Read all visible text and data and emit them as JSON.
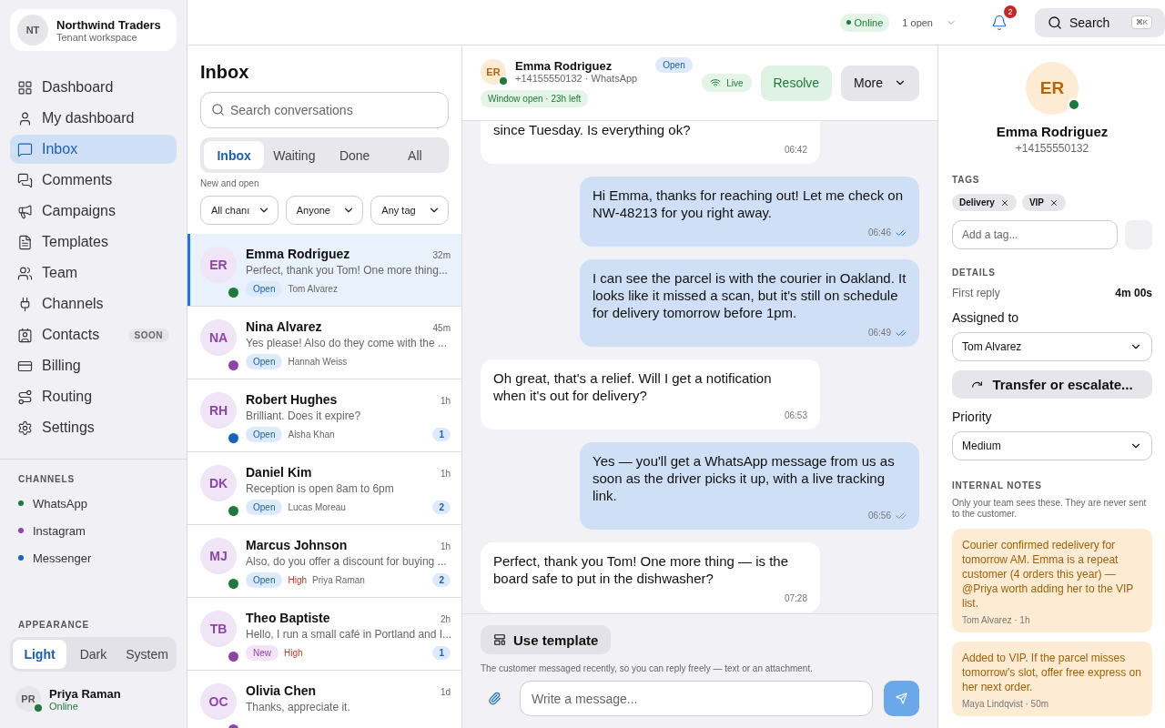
{
  "workspace": {
    "initials": "NT",
    "name": "Northwind Traders",
    "subtitle": "Tenant workspace"
  },
  "nav": [
    {
      "label": "Dashboard",
      "selected": false
    },
    {
      "label": "My dashboard",
      "selected": false
    },
    {
      "label": "Inbox",
      "selected": true
    },
    {
      "label": "Comments",
      "selected": false
    },
    {
      "label": "Campaigns",
      "selected": false
    },
    {
      "label": "Templates",
      "selected": false
    },
    {
      "label": "Team",
      "selected": false
    },
    {
      "label": "Channels",
      "selected": false
    },
    {
      "label": "Contacts",
      "selected": false,
      "badge": "SOON"
    },
    {
      "label": "Billing",
      "selected": false
    },
    {
      "label": "Routing",
      "selected": false
    },
    {
      "label": "Settings",
      "selected": false
    }
  ],
  "channels": {
    "title": "CHANNELS",
    "items": [
      {
        "label": "WhatsApp",
        "color": "#1e7a3a"
      },
      {
        "label": "Instagram",
        "color": "#8e44ad"
      },
      {
        "label": "Messenger",
        "color": "#1565c0"
      }
    ]
  },
  "appearance": {
    "title": "APPEARANCE",
    "options": [
      {
        "label": "Light",
        "selected": true
      },
      {
        "label": "Dark",
        "selected": false
      },
      {
        "label": "System",
        "selected": false
      }
    ]
  },
  "user": {
    "initials": "PR",
    "name": "Priya Raman",
    "status": "Online"
  },
  "topbar": {
    "status": "Online",
    "open_count": "1 open",
    "notifications": "2",
    "search": "Search",
    "shortcut": "⌘K"
  },
  "inbox": {
    "title": "Inbox",
    "search_placeholder": "Search conversations",
    "tabs": [
      {
        "label": "Inbox",
        "selected": true
      },
      {
        "label": "Waiting",
        "selected": false
      },
      {
        "label": "Done",
        "selected": false
      },
      {
        "label": "All",
        "selected": false
      }
    ],
    "hint": "New and open",
    "filters": [
      "All chanı",
      "Anyone",
      "Any tag"
    ],
    "conversations": [
      {
        "initials": "ER",
        "name": "Emma Rodriguez",
        "time": "32m",
        "preview": "Perfect, thank you Tom! One more thing...",
        "status": "Open",
        "new": false,
        "agent": "Tom Alvarez",
        "color": "#1e7a3a",
        "selected": true
      },
      {
        "initials": "NA",
        "name": "Nina Alvarez",
        "time": "45m",
        "preview": "Yes please! Also do they come with the ...",
        "status": "Open",
        "new": false,
        "agent": "Hannah Weiss",
        "color": "#8e44ad",
        "selected": false
      },
      {
        "initials": "RH",
        "name": "Robert Hughes",
        "time": "1h",
        "preview": "Brilliant. Does it expire?",
        "status": "Open",
        "new": false,
        "agent": "Aisha Khan",
        "unread": "1",
        "color": "#1565c0",
        "selected": false
      },
      {
        "initials": "DK",
        "name": "Daniel Kim",
        "time": "1h",
        "preview": "Reception is open 8am to 6pm",
        "status": "Open",
        "new": false,
        "agent": "Lucas Moreau",
        "unread": "2",
        "color": "#1e7a3a",
        "selected": false
      },
      {
        "initials": "MJ",
        "name": "Marcus Johnson",
        "time": "1h",
        "preview": "Also, do you offer a discount for buying ...",
        "status": "Open",
        "new": false,
        "priority": "High",
        "agent": "Priya Raman",
        "unread": "2",
        "color": "#1e7a3a",
        "selected": false
      },
      {
        "initials": "TB",
        "name": "Theo Baptiste",
        "time": "2h",
        "preview": "Hello, I run a small café in Portland and I...",
        "status": "New",
        "new": true,
        "priority": "High",
        "unread": "1",
        "color": "#8e44ad",
        "selected": false
      },
      {
        "initials": "OC",
        "name": "Olivia Chen",
        "time": "1d",
        "preview": "Thanks, appreciate it.",
        "color": "#8e44ad",
        "selected": false
      }
    ]
  },
  "chat": {
    "initials": "ER",
    "name": "Emma Rodriguez",
    "subtitle": "+14155550132 · WhatsApp",
    "status": "Open",
    "window": "Window open · 23h left",
    "live": "Live",
    "resolve": "Resolve",
    "more": "More",
    "messages": [
      {
        "kind": "inbound",
        "text": "since Tuesday. Is everything ok?",
        "time": "06:42"
      },
      {
        "kind": "outbound",
        "text": "Hi Emma, thanks for reaching out! Let me check on NW-48213 for you right away.",
        "time": "06:46",
        "read": true
      },
      {
        "kind": "outbound",
        "text": "I can see the parcel is with the courier in Oakland. It looks like it missed a scan, but it's still on schedule for delivery tomorrow before 1pm.",
        "time": "06:49",
        "read": true
      },
      {
        "kind": "inbound",
        "text": "Oh great, that's a relief. Will I get a notification when it's out for delivery?",
        "time": "06:53"
      },
      {
        "kind": "outbound",
        "text": "Yes — you'll get a WhatsApp message from us as soon as the driver picks it up, with a live tracking link.",
        "time": "06:56",
        "read": false
      },
      {
        "kind": "inbound",
        "text": "Perfect, thank you Tom! One more thing — is the board safe to put in the dishwasher?",
        "time": "07:28"
      }
    ],
    "template": "Use template",
    "hint": "The customer messaged recently, so you can reply freely — text or an attachment.",
    "placeholder": "Write a message..."
  },
  "contact": {
    "initials": "ER",
    "name": "Emma Rodriguez",
    "phone": "+14155550132",
    "tags_title": "TAGS",
    "tags": [
      "Delivery",
      "VIP"
    ],
    "tag_placeholder": "Add a tag...",
    "details_title": "DETAILS",
    "first_reply_label": "First reply",
    "first_reply": "4m 00s",
    "assigned_label": "Assigned to",
    "assigned": "Tom Alvarez",
    "transfer": "Transfer or escalate...",
    "priority_label": "Priority",
    "priority": "Medium",
    "notes_title": "INTERNAL NOTES",
    "notes_hint": "Only your team sees these. They are never sent to the customer.",
    "notes": [
      {
        "text": "Courier confirmed redelivery for tomorrow AM. Emma is a repeat customer (4 orders this year) — @Priya worth adding her to the VIP list.",
        "author": "Tom Alvarez · 1h"
      },
      {
        "text": "Added to VIP. If the parcel misses tomorrow's slot, offer free express on her next order.",
        "author": "Maya Lindqvist · 50m"
      }
    ]
  }
}
